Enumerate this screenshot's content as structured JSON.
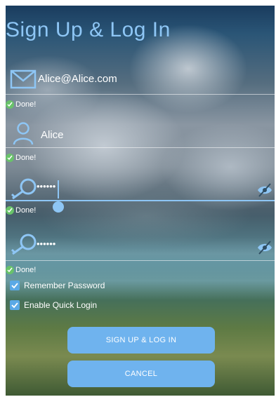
{
  "title": "Sign Up & Log In",
  "email": {
    "value": "Alice@Alice.com",
    "status": "Done!",
    "icon": "envelope-icon"
  },
  "username": {
    "value": "Alice",
    "status": "Done!",
    "icon": "person-icon"
  },
  "password": {
    "value": "••••••",
    "status": "Done!",
    "icon": "key-icon",
    "toggle_icon": "eye-off-icon"
  },
  "confirm_password": {
    "value": "••••••",
    "status": "Done!",
    "icon": "key-icon",
    "toggle_icon": "eye-off-icon"
  },
  "options": {
    "remember_password": {
      "label": "Remember Password",
      "checked": true
    },
    "quick_login": {
      "label": "Enable Quick Login",
      "checked": true
    }
  },
  "buttons": {
    "signup_login": "SIGN UP & LOG IN",
    "cancel": "CANCEL"
  },
  "colors": {
    "accent": "#8ec6f5",
    "button": "#6fb3ee",
    "success": "#69c36a"
  }
}
